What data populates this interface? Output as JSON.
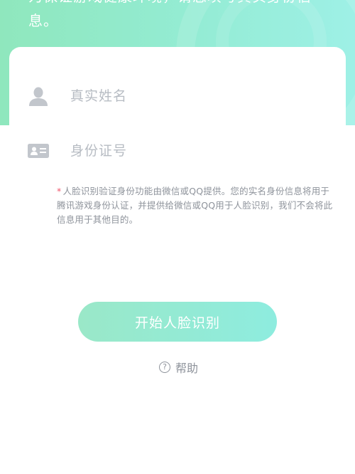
{
  "header": {
    "intro_text": "为保证游戏健康环境，请您填写真实身份信息。"
  },
  "form": {
    "name_field": {
      "placeholder": "真实姓名",
      "value": ""
    },
    "id_field": {
      "placeholder": "身份证号",
      "value": ""
    },
    "notice_star": "*",
    "notice_text": "人脸识别验证身份功能由微信或QQ提供。您的实名身份信息将用于腾讯游戏身份认证，并提供给微信或QQ用于人脸识别，我们不会将此信息用于其他目的。"
  },
  "actions": {
    "start_label": "开始人脸识别",
    "help_icon_glyph": "?",
    "help_label": "帮助"
  },
  "icons": {
    "name_field_icon": "person-icon",
    "id_field_icon": "id-card-icon",
    "help_icon": "question-circle-icon"
  },
  "colors": {
    "accent_start": "#8fe7bd",
    "accent_end": "#9ef0e6",
    "placeholder": "#b7bcc3",
    "notice_star": "#f0566b"
  }
}
